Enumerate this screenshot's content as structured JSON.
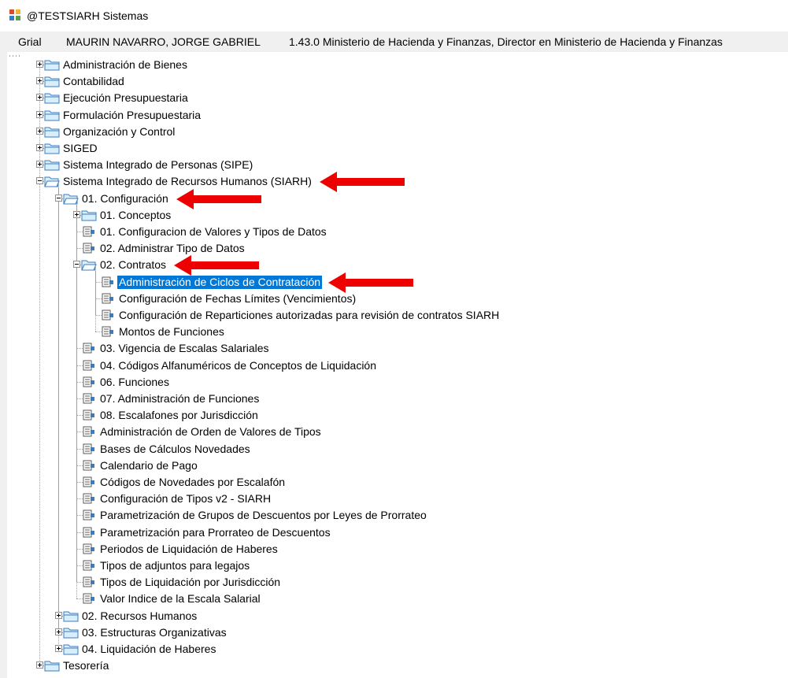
{
  "window": {
    "title": "@TESTSIARH Sistemas"
  },
  "menubar": {
    "items": [
      "Grial",
      "MAURIN NAVARRO, JORGE GABRIEL",
      "1.43.0 Ministerio de Hacienda y Finanzas, Director en Ministerio de Hacienda y Finanzas"
    ]
  },
  "tree": [
    {
      "label": "Administración de Bienes",
      "level": 0,
      "type": "folder",
      "expander": "plus"
    },
    {
      "label": "Contabilidad",
      "level": 0,
      "type": "folder",
      "expander": "plus"
    },
    {
      "label": "Ejecución Presupuestaria",
      "level": 0,
      "type": "folder",
      "expander": "plus"
    },
    {
      "label": "Formulación Presupuestaria",
      "level": 0,
      "type": "folder",
      "expander": "plus"
    },
    {
      "label": "Organización y Control",
      "level": 0,
      "type": "folder",
      "expander": "plus"
    },
    {
      "label": "SIGED",
      "level": 0,
      "type": "folder",
      "expander": "plus"
    },
    {
      "label": "Sistema Integrado de Personas (SIPE)",
      "level": 0,
      "type": "folder",
      "expander": "plus"
    },
    {
      "label": "Sistema Integrado de Recursos Humanos (SIARH)",
      "level": 0,
      "type": "folder",
      "expander": "minus",
      "arrow": true
    },
    {
      "label": "01. Configuración",
      "level": 1,
      "type": "folder",
      "expander": "minus",
      "arrow": true
    },
    {
      "label": "01. Conceptos",
      "level": 2,
      "type": "folder",
      "expander": "plus"
    },
    {
      "label": "01. Configuracion de Valores y Tipos de Datos",
      "level": 2,
      "type": "doc"
    },
    {
      "label": "02. Administrar Tipo de Datos",
      "level": 2,
      "type": "doc"
    },
    {
      "label": "02. Contratos",
      "level": 2,
      "type": "folder",
      "expander": "minus",
      "arrow": true
    },
    {
      "label": "Administración de Ciclos de Contratación",
      "level": 3,
      "type": "doc",
      "selected": true,
      "arrow": true
    },
    {
      "label": "Configuración de Fechas Límites (Vencimientos)",
      "level": 3,
      "type": "doc"
    },
    {
      "label": "Configuración de Reparticiones autorizadas para revisión de contratos SIARH",
      "level": 3,
      "type": "doc"
    },
    {
      "label": "Montos de Funciones",
      "level": 3,
      "type": "doc"
    },
    {
      "label": "03. Vigencia de Escalas Salariales",
      "level": 2,
      "type": "doc"
    },
    {
      "label": "04. Códigos Alfanuméricos de Conceptos de Liquidación",
      "level": 2,
      "type": "doc"
    },
    {
      "label": "06. Funciones",
      "level": 2,
      "type": "doc"
    },
    {
      "label": "07. Administración de Funciones",
      "level": 2,
      "type": "doc"
    },
    {
      "label": "08. Escalafones por Jurisdicción",
      "level": 2,
      "type": "doc"
    },
    {
      "label": "Administración de Orden de Valores de Tipos",
      "level": 2,
      "type": "doc"
    },
    {
      "label": "Bases de Cálculos Novedades",
      "level": 2,
      "type": "doc"
    },
    {
      "label": "Calendario de Pago",
      "level": 2,
      "type": "doc"
    },
    {
      "label": "Códigos de Novedades por Escalafón",
      "level": 2,
      "type": "doc"
    },
    {
      "label": "Configuración de Tipos v2 - SIARH",
      "level": 2,
      "type": "doc"
    },
    {
      "label": "Parametrización de Grupos de Descuentos por Leyes de Prorrateo",
      "level": 2,
      "type": "doc"
    },
    {
      "label": "Parametrización para Prorrateo de Descuentos",
      "level": 2,
      "type": "doc"
    },
    {
      "label": "Periodos de Liquidación de Haberes",
      "level": 2,
      "type": "doc"
    },
    {
      "label": "Tipos de adjuntos para legajos",
      "level": 2,
      "type": "doc"
    },
    {
      "label": "Tipos de Liquidación por Jurisdicción",
      "level": 2,
      "type": "doc"
    },
    {
      "label": "Valor Indice de la Escala Salarial",
      "level": 2,
      "type": "doc"
    },
    {
      "label": "02. Recursos Humanos",
      "level": 1,
      "type": "folder",
      "expander": "plus"
    },
    {
      "label": "03. Estructuras Organizativas",
      "level": 1,
      "type": "folder",
      "expander": "plus"
    },
    {
      "label": "04. Liquidación de Haberes",
      "level": 1,
      "type": "folder",
      "expander": "plus"
    },
    {
      "label": "Tesorería",
      "level": 0,
      "type": "folder",
      "expander": "plus"
    }
  ],
  "colors": {
    "selection": "#0078d7",
    "annotation_arrow": "#ee0000",
    "folder_fill": "#d8eefa",
    "folder_stroke": "#3a7cc0"
  },
  "icons": {
    "folder": "folder-icon",
    "doc": "form-item-icon",
    "plus": "plus-expander-icon",
    "minus": "minus-expander-icon",
    "annotation": "red-arrow-icon"
  }
}
